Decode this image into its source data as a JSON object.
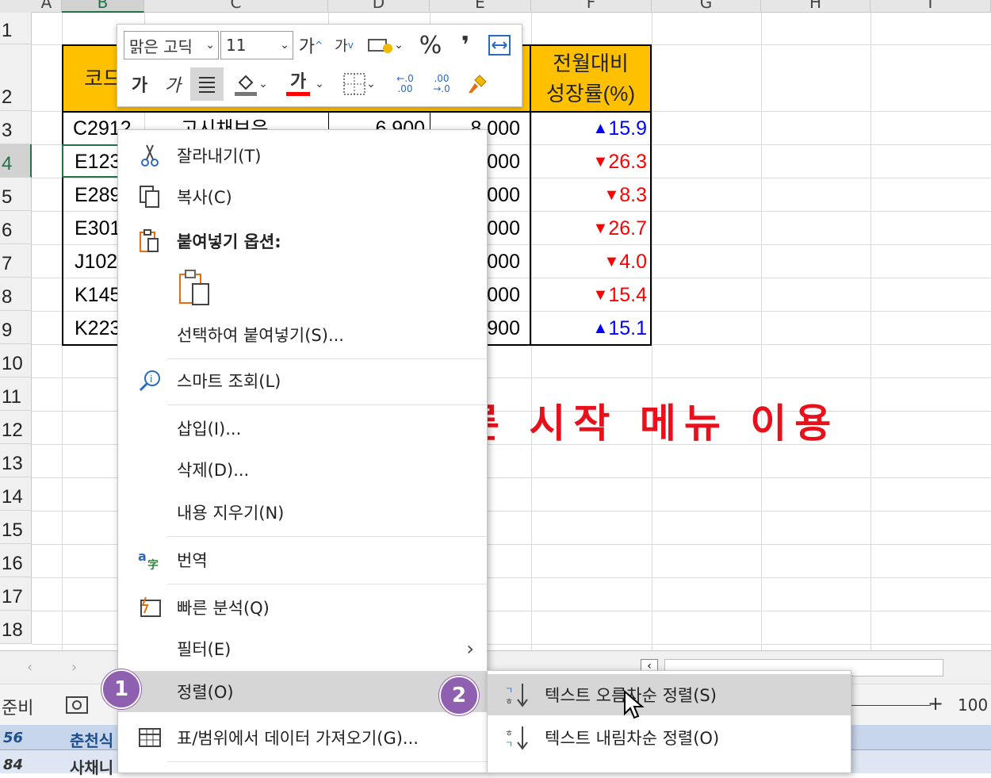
{
  "columns": [
    "A",
    "B",
    "C",
    "D",
    "E",
    "F",
    "G",
    "H",
    "I"
  ],
  "rows": [
    "1",
    "2",
    "3",
    "4",
    "5",
    "6",
    "7",
    "8",
    "9",
    "10",
    "11",
    "12",
    "13",
    "14",
    "15",
    "16",
    "17",
    "18"
  ],
  "table": {
    "header_code": "코드",
    "header_growth_line1": "전월대비",
    "header_growth_line2": "성장률(%)",
    "codes": [
      "C2912",
      "E123",
      "E289",
      "E301",
      "J102",
      "K145",
      "K223"
    ],
    "name_partial": "고시채보은",
    "d_partial": "6,900",
    "e_values": [
      "8,000",
      "000",
      "000",
      "000",
      "000",
      "000",
      "900"
    ],
    "growth": [
      {
        "arrow": "▲",
        "value": "15.9",
        "dir": "up"
      },
      {
        "arrow": "▼",
        "value": "26.3",
        "dir": "down"
      },
      {
        "arrow": "▼",
        "value": "8.3",
        "dir": "down"
      },
      {
        "arrow": "▼",
        "value": "26.7",
        "dir": "down"
      },
      {
        "arrow": "▼",
        "value": "4.0",
        "dir": "down"
      },
      {
        "arrow": "▼",
        "value": "15.4",
        "dir": "down"
      },
      {
        "arrow": "▲",
        "value": "15.1",
        "dir": "up"
      }
    ]
  },
  "annotation": "빠른 시작 메뉴 이용",
  "minibar": {
    "font_name": "맑은 고딕",
    "font_size": "11",
    "increase_font": "가",
    "decrease_font": "가",
    "percent": "%",
    "comma": "❜",
    "bold": "가",
    "italic": "가",
    "font_color": "가",
    "inc_decimal": "←.0 .00",
    "dec_decimal": ".00 →.0"
  },
  "context_menu": {
    "cut": "잘라내기(T)",
    "copy": "복사(C)",
    "paste_options": "붙여넣기 옵션:",
    "paste_special": "선택하여 붙여넣기(S)...",
    "smart_lookup": "스마트 조회(L)",
    "insert": "삽입(I)...",
    "delete": "삭제(D)...",
    "clear": "내용 지우기(N)",
    "translate": "번역",
    "quick_analysis": "빠른 분석(Q)",
    "filter": "필터(E)",
    "sort": "정렬(O)",
    "get_data": "표/범위에서 데이터 가져오기(G)..."
  },
  "submenu": {
    "sort_asc": "텍스트 오름차순 정렬(S)",
    "sort_desc": "텍스트 내림차순 정렬(O)"
  },
  "badges": [
    "1",
    "2"
  ],
  "status": {
    "ready": "준비",
    "zoom": "100"
  },
  "below_cells": {
    "row56": "56",
    "row56_val": "춘천식",
    "row84": "84",
    "row84_val": "사채니"
  },
  "colors": {
    "header_fill": "#ffc000",
    "up": "#0000ff",
    "down": "#ff0000",
    "annotation": "#e8111b",
    "badge": "#8f5fb0",
    "highlight": "#d6d6d6"
  }
}
